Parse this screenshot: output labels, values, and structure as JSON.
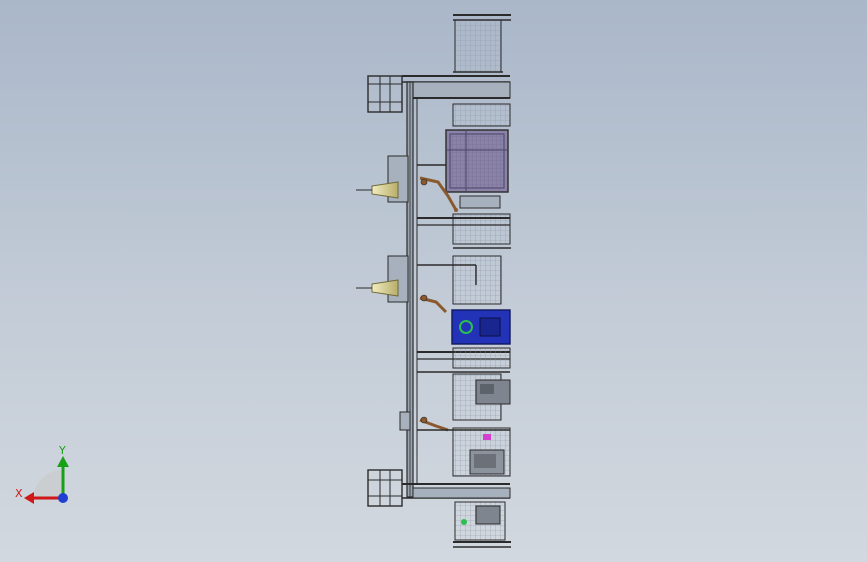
{
  "viewport": {
    "background_top": "#aab7c9",
    "background_bottom": "#d2d8df"
  },
  "triad": {
    "x_label": "X",
    "y_label": "Y",
    "x_color": "#d01818",
    "y_color": "#18a018",
    "z_color": "#1f3fd0"
  },
  "model": {
    "frame_color": "#2b2b2b",
    "guard_color": "#b9c3cf",
    "machine_purple": "#8a82a8",
    "machine_blue": "#2233b8",
    "robot_color": "#8a5a2e",
    "tank_color": "#d8cf8a",
    "accent_green": "#2bbf4f",
    "accent_magenta": "#d23fd0"
  }
}
